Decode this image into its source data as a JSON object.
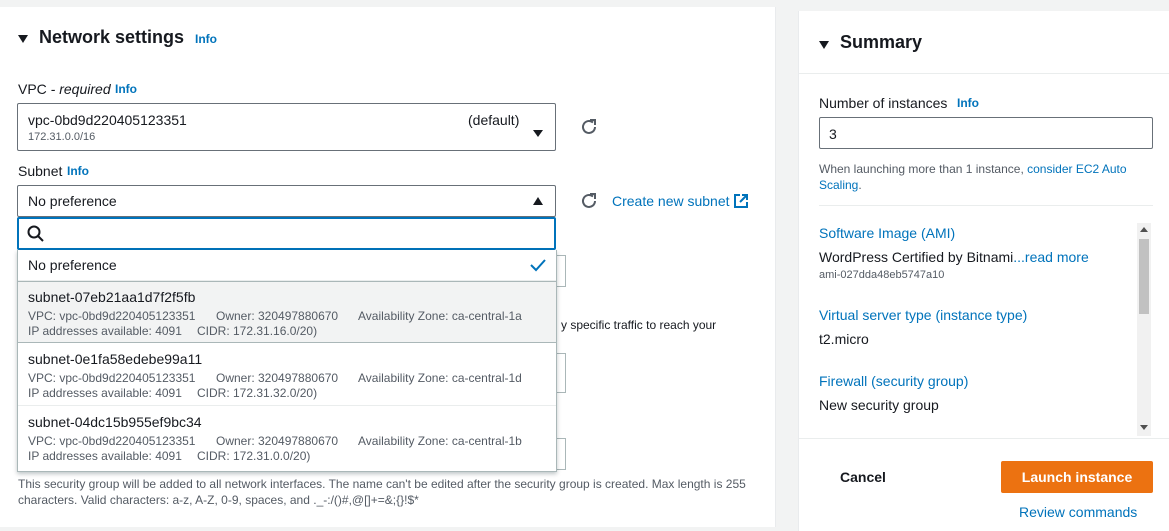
{
  "network": {
    "title": "Network settings",
    "info": "Info",
    "vpc_label": "VPC",
    "vpc_required": " - required",
    "vpc_info": "Info",
    "vpc_value": "vpc-0bd9d220405123351",
    "vpc_default": "(default)",
    "vpc_cidr": "172.31.0.0/16",
    "subnet_label": "Subnet",
    "subnet_info": "Info",
    "subnet_value": "No preference",
    "create_subnet": "Create new subnet",
    "search_placeholder": "",
    "options": [
      {
        "title": "No preference",
        "selected": true
      },
      {
        "title": "subnet-07eb21aa1d7f2f5fb",
        "vpc": "VPC: vpc-0bd9d220405123351",
        "owner": "Owner: 320497880670",
        "az": "Availability Zone: ca-central-1a",
        "ips": "IP addresses available: 4091",
        "cidr": "CIDR: 172.31.16.0/20)"
      },
      {
        "title": "subnet-0e1fa58edebe99a11",
        "vpc": "VPC: vpc-0bd9d220405123351",
        "owner": "Owner: 320497880670",
        "az": "Availability Zone: ca-central-1d",
        "ips": "IP addresses available: 4091",
        "cidr": "CIDR: 172.31.32.0/20)"
      },
      {
        "title": "subnet-04dc15b955ef9bc34",
        "vpc": "VPC: vpc-0bd9d220405123351",
        "owner": "Owner: 320497880670",
        "az": "Availability Zone: ca-central-1b",
        "ips": "IP addresses available: 4091",
        "cidr": "CIDR: 172.31.0.0/20)"
      }
    ],
    "partial_text": "y specific traffic to reach your",
    "sg_help": "This security group will be added to all network interfaces. The name can't be edited after the security group is created. Max length is 255 characters. Valid characters: a-z, A-Z, 0-9, spaces, and ._-:/()#,@[]+=&;{}!$*"
  },
  "summary": {
    "title": "Summary",
    "instances_label": "Number of instances",
    "instances_info": "Info",
    "instances_value": "3",
    "help_prefix": "When launching more than 1 instance, ",
    "help_link": "consider EC2 Auto Scaling",
    "help_suffix": ".",
    "ami_label": "Software Image (AMI)",
    "ami_value": "WordPress Certified by Bitnami",
    "ami_more": "...read more",
    "ami_id": "ami-027dda48eb5747a10",
    "type_label": "Virtual server type (instance type)",
    "type_value": "t2.micro",
    "fw_label": "Firewall (security group)",
    "fw_value": "New security group",
    "cancel": "Cancel",
    "launch": "Launch instance",
    "review": "Review commands"
  },
  "colors": {
    "link": "#0073bb",
    "primary": "#ec7211",
    "check": "#0073bb"
  }
}
